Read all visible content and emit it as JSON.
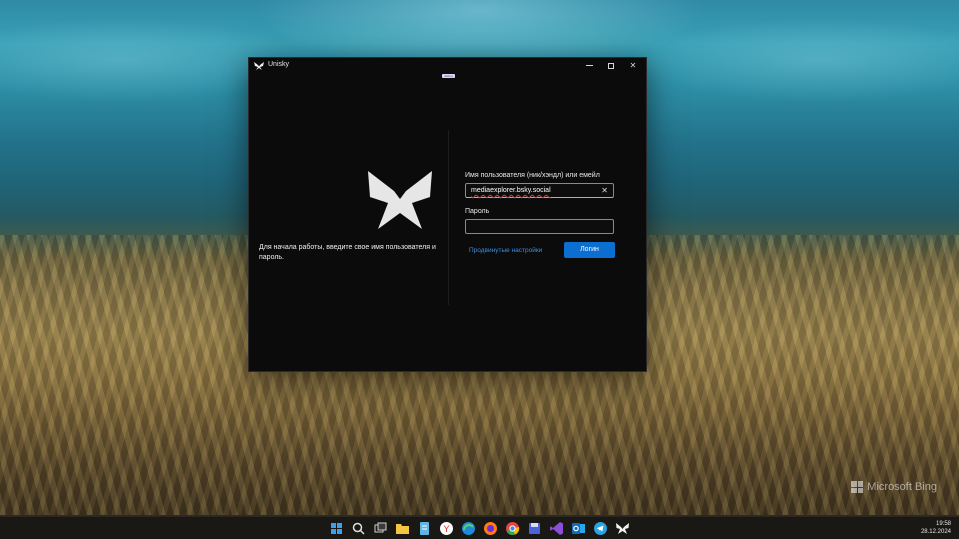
{
  "window": {
    "title": "Unisky",
    "top_badge": "debug",
    "welcome_text": "Для начала работы, введите свое имя пользователя и пароль.",
    "username_label": "Имя пользователя (ник/хэндл) или емейл",
    "username_value": "mediaexplorer.bsky.social",
    "password_label": "Пароль",
    "password_value": "",
    "advanced_link": "Продвинутые настройки",
    "login_button": "Логин",
    "accent_color": "#0a6fd1"
  },
  "desktop": {
    "watermark": "Microsoft Bing"
  },
  "taskbar": {
    "icons": [
      "windows-start-icon",
      "search-icon",
      "task-view-icon",
      "file-explorer-icon",
      "notepad-icon",
      "yandex-browser-icon",
      "edge-icon",
      "firefox-icon",
      "chrome-icon",
      "save-app-icon",
      "visual-studio-icon",
      "outlook-icon",
      "telegram-icon",
      "unisky-icon"
    ],
    "time": "19:58",
    "date": "28.12.2024"
  }
}
